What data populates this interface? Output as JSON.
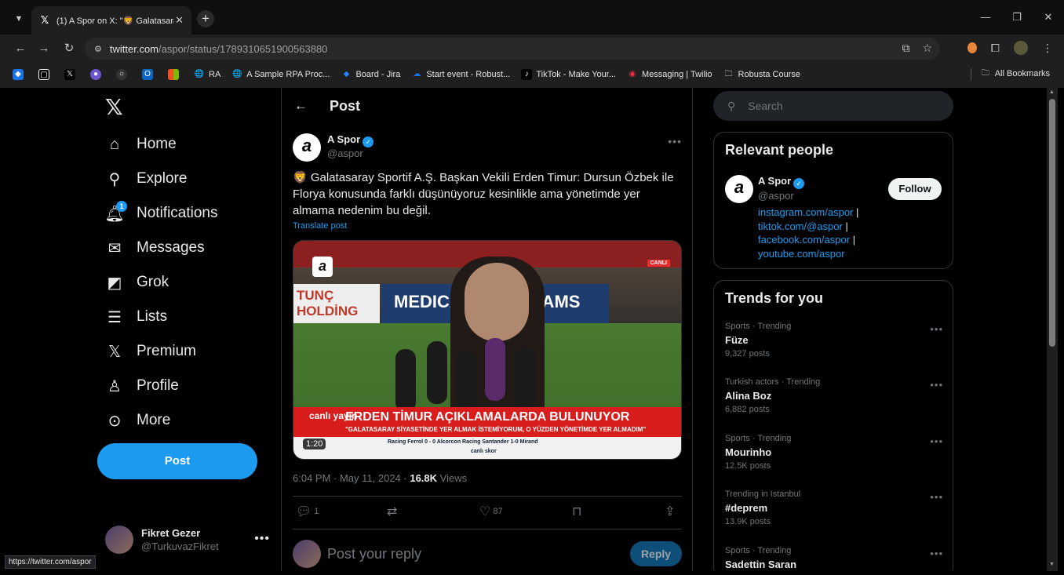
{
  "browser": {
    "tab_title": "(1) A Spor on X: \"🦁 Galatasara",
    "url_host": "twitter.com",
    "url_path": "/aspor/status/1789310651900563880",
    "bookmarks": [
      {
        "label": "",
        "icon": "diamond-icon",
        "color": "#1a73e8"
      },
      {
        "label": "",
        "icon": "square-icon",
        "color": "#000000"
      },
      {
        "label": "",
        "icon": "x-icon",
        "color": "#000000"
      },
      {
        "label": "",
        "icon": "vivaldi-icon",
        "color": "#6e56cf"
      },
      {
        "label": "",
        "icon": "github-icon",
        "color": "#333333"
      },
      {
        "label": "",
        "icon": "outlook-icon",
        "color": "#0a66c2"
      },
      {
        "label": "",
        "icon": "microsoft-icon",
        "color": "#f25022"
      },
      {
        "label": "RA",
        "icon": "globe-icon",
        "color": "#5f6368"
      },
      {
        "label": "A Sample RPA Proc...",
        "icon": "globe-icon",
        "color": "#5f6368"
      },
      {
        "label": "Board - Jira",
        "icon": "jira-icon",
        "color": "#2684ff"
      },
      {
        "label": "Start event - Robust...",
        "icon": "cloud-icon",
        "color": "#1a73e8"
      },
      {
        "label": "TikTok - Make Your...",
        "icon": "tiktok-icon",
        "color": "#000000"
      },
      {
        "label": "Messaging | Twilio",
        "icon": "twilio-icon",
        "color": "#f22f46"
      },
      {
        "label": "Robusta Course",
        "icon": "folder-icon",
        "color": "transparent"
      }
    ],
    "all_bookmarks": "All Bookmarks",
    "status_url": "https://twitter.com/aspor"
  },
  "nav": {
    "items": [
      {
        "label": "Home",
        "icon": "home-icon"
      },
      {
        "label": "Explore",
        "icon": "search-icon"
      },
      {
        "label": "Notifications",
        "icon": "bell-icon",
        "badge": "1"
      },
      {
        "label": "Messages",
        "icon": "envelope-icon"
      },
      {
        "label": "Grok",
        "icon": "grok-icon"
      },
      {
        "label": "Lists",
        "icon": "list-icon"
      },
      {
        "label": "Premium",
        "icon": "x-icon"
      },
      {
        "label": "Profile",
        "icon": "person-icon"
      },
      {
        "label": "More",
        "icon": "more-circle-icon"
      }
    ],
    "post_button": "Post",
    "account_name": "Fikret Gezer",
    "account_handle": "@TurkuvazFikret"
  },
  "post": {
    "header_title": "Post",
    "author_name": "A Spor",
    "author_handle": "@aspor",
    "text": "🦁 Galatasaray Sportif A.Ş. Başkan Vekili Erden Timur: Dursun Özbek ile Florya konusunda farklı düşünüyoruz kesinlikle ama yönetimde yer almama nedenim bu değil.",
    "translate": "Translate post",
    "video": {
      "board_left": "TUNÇ HOLDİNG",
      "board_mid": "MEDICAN",
      "board_right": "RAMS",
      "live_badge": "CANLI",
      "lower_live": "canlı yayın",
      "lower_title": "ERDEN TİMUR AÇIKLAMALARDA BULUNUYOR",
      "lower_sub": "\"GALATASARAY SİYASETİNDE YER ALMAK İSTEMİYORUM, O YÜZDEN YÖNETİMDE YER ALMADIM\"",
      "ticker": "Racing Ferrol 0 - 0 Alcorcon    Racing Santander 1-0 Mirand",
      "ticker_sub": "canlı skor",
      "duration": "1:20"
    },
    "timestamp": "6:04 PM · May 11, 2024 · ",
    "views_count": "16.8K",
    "views_label": " Views",
    "replies": "1",
    "likes": "87",
    "reply_placeholder": "Post your reply",
    "reply_button": "Reply"
  },
  "right": {
    "search_placeholder": "Search",
    "relevant_title": "Relevant people",
    "person_name": "A Spor",
    "person_handle": "@aspor",
    "links": [
      "instagram.com/aspor",
      "tiktok.com/@aspor",
      "facebook.com/aspor",
      "youtube.com/aspor"
    ],
    "follow_button": "Follow",
    "trends_title": "Trends for you",
    "trends": [
      {
        "category": "Sports · Trending",
        "name": "Füze",
        "count": "9,327 posts"
      },
      {
        "category": "Turkish actors · Trending",
        "name": "Alina Boz",
        "count": "6,882 posts"
      },
      {
        "category": "Sports · Trending",
        "name": "Mourinho",
        "count": "12.5K posts"
      },
      {
        "category": "Trending in Istanbul",
        "name": "#deprem",
        "count": "13.9K posts"
      },
      {
        "category": "Sports · Trending",
        "name": "Sadettin Saran",
        "count": ""
      }
    ]
  }
}
